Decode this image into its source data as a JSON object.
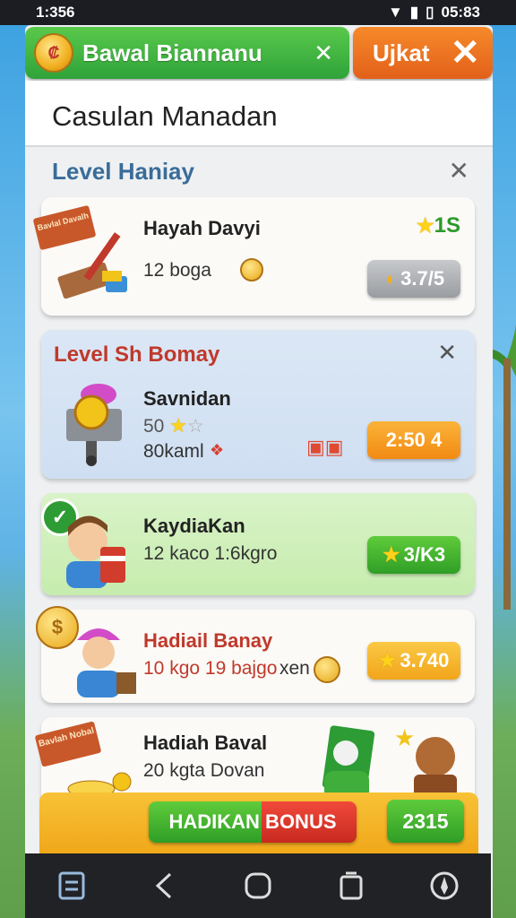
{
  "status": {
    "time": "1:356",
    "clock": "05:83"
  },
  "header": {
    "title": "Bawal Biannanu",
    "update_label": "Ujkat",
    "coin_mark": "₡"
  },
  "page_title": "Casulan Manadan",
  "section": {
    "title": "Level Haniay"
  },
  "cards": [
    {
      "badge": "Bavlal Davalh",
      "name": "Hayah Davyi",
      "sub": "12 boga",
      "reward": "1S",
      "price": "3.7/5"
    },
    {
      "section_title": "Level Sh Bomay",
      "name": "Savnidan",
      "rating": "50",
      "sub": "80kaml",
      "timer": "2:50 4"
    },
    {
      "name": "KaydiaKan",
      "sub": "12 kaco 1:6kgro",
      "price": "3/K3"
    },
    {
      "name": "Hadiail Banay",
      "sub": "10 kgo 19 bajgo",
      "sub_extra": "xen",
      "price": "3.740"
    },
    {
      "badge": "Bavlah Nobal",
      "name": "Hadiah Baval",
      "sub": "20 kgta Dovan"
    }
  ],
  "banner": {
    "bonus_label": "HADIKAN BONUS",
    "count": "2315"
  },
  "colors": {
    "green": "#2fa33a",
    "orange": "#e2601a",
    "gold": "#f0a618"
  }
}
